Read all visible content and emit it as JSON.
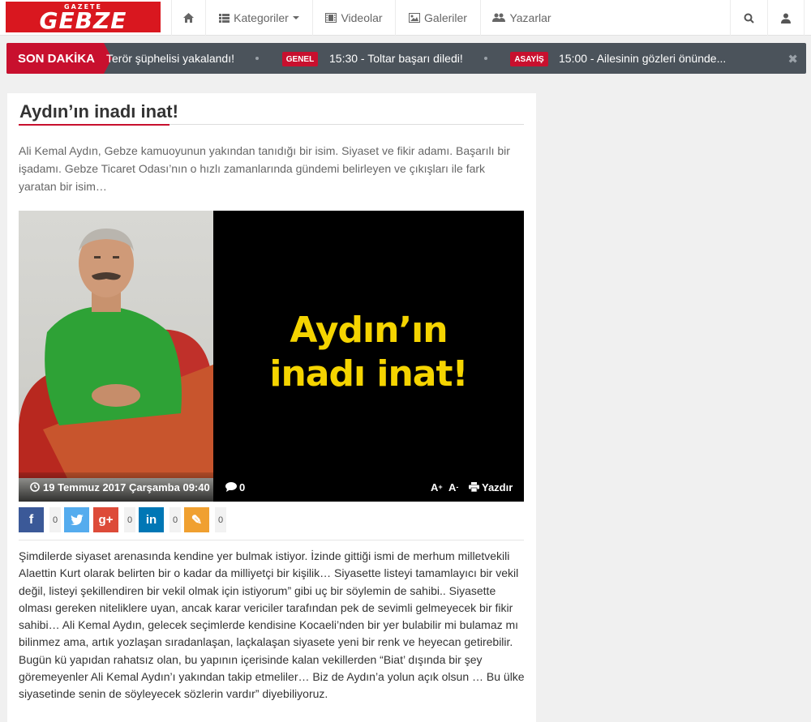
{
  "brand": {
    "logo_small": "GAZETE",
    "logo_main": "GEBZE"
  },
  "nav": {
    "home_icon": "home-icon",
    "categories": "Kategoriler",
    "videos": "Videolar",
    "galleries": "Galeriler",
    "authors": "Yazarlar",
    "search_icon": "search-icon",
    "user_icon": "user-icon"
  },
  "ticker": {
    "label": "SON DAKİKA",
    "items": [
      {
        "badge": "",
        "text": "Terör şüphelisi yakalandı!"
      },
      {
        "badge": "GENEL",
        "text": "15:30 - Toltar başarı diledi!"
      },
      {
        "badge": "ASAYİŞ",
        "text": "15:00 - Ailesinin gözleri önünde..."
      }
    ],
    "close": "✖"
  },
  "article": {
    "title": "Aydın’ın inadı inat!",
    "summary": "Ali Kemal Aydın, Gebze kamuoyunun yakından tanıdığı bir isim. Siyaset ve fikir adamı. Başarılı bir işadamı. Gebze Ticaret Odası’nın o hızlı zamanlarında gündemi belirleyen ve çıkışları ile fark yaratan bir isim…",
    "image_headline_1": "Aydın’ın",
    "image_headline_2": "inadı inat!",
    "date": "19 Temmuz 2017 Çarşamba 09:40",
    "comments": "0",
    "font_up": "A",
    "font_down": "A",
    "print": "Yazdır",
    "share": [
      {
        "network": "facebook",
        "glyph": "f",
        "count": "0",
        "color": "#3b5998"
      },
      {
        "network": "twitter",
        "glyph": "t",
        "count": "",
        "color": "#55acee"
      },
      {
        "network": "google-plus",
        "glyph": "g+",
        "count": "0",
        "color": "#dd4b39"
      },
      {
        "network": "linkedin",
        "glyph": "in",
        "count": "0",
        "color": "#0077b5"
      },
      {
        "network": "comment",
        "glyph": "✎",
        "count": "0",
        "color": "#f0a030"
      }
    ],
    "body": "Şimdilerde siyaset arenasında kendine yer bulmak istiyor. İzinde gittiği ismi de merhum milletvekili Alaettin Kurt olarak belirten bir o kadar da milliyetçi bir kişilik… Siyasette listeyi tamamlayıcı bir vekil değil, listeyi şekillendiren bir vekil olmak için istiyorum” gibi uç bir söylemin de sahibi.. Siyasette olması gereken niteliklere uyan, ancak karar vericiler tarafından pek de sevimli gelmeyecek bir fikir sahibi… Ali Kemal Aydın, gelecek seçimlerde kendisine Kocaeli’nden bir yer bulabilir mi bulamaz mı bilinmez ama, artık yozlaşan sıradanlaşan, laçkalaşan siyasete yeni bir renk ve heyecan getirebilir. Bugün kü yapıdan rahatsız olan, bu yapının içerisinde kalan vekillerden “Biat’ dışında bir şey göremeyenler Ali Kemal Aydın’ı yakından takip etmeliler… Biz de Aydın’a yolun açık olsun … Bu ülke siyasetinde senin de söyleyecek sözlerin vardır” diyebiliyoruz."
  },
  "colors": {
    "brand_red": "#c8102e",
    "ticker_bg": "#4b535b",
    "headline_yellow": "#f5d400"
  }
}
